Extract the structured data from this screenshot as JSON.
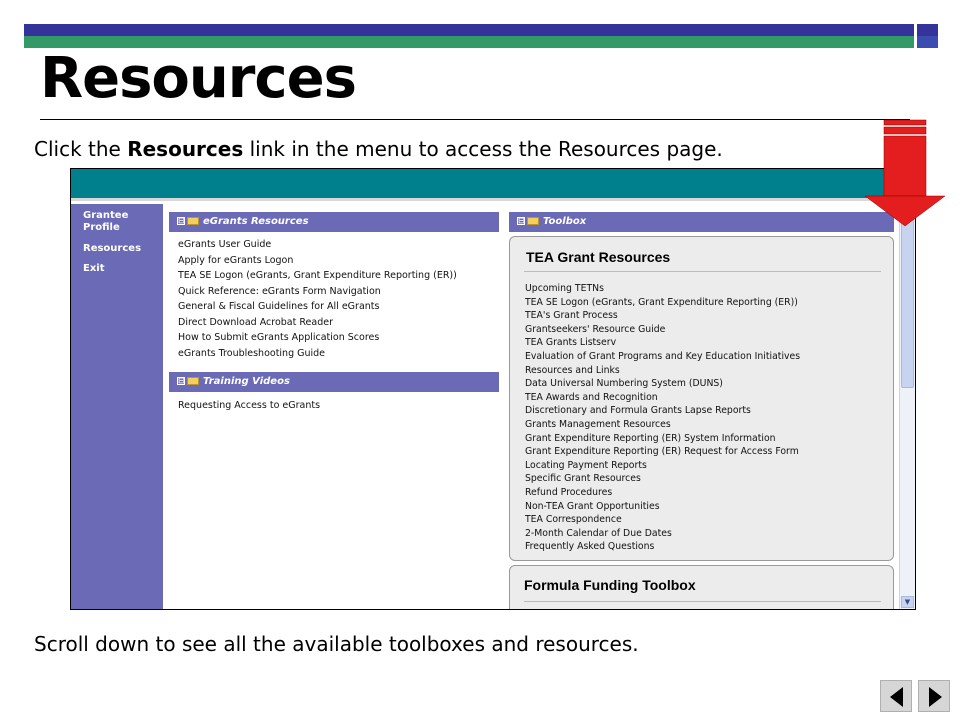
{
  "slide": {
    "title": "Resources",
    "intro_pre": "Click the ",
    "intro_bold": "Resources",
    "intro_post": " link in the menu to access the Resources page.",
    "footer": "Scroll down to see all the available toolboxes and resources."
  },
  "sidebar": {
    "items": [
      {
        "label": "Grantee Profile"
      },
      {
        "label": "Resources"
      },
      {
        "label": "Exit"
      }
    ]
  },
  "egrants": {
    "header": "eGrants Resources",
    "links": [
      "eGrants User Guide",
      "Apply for eGrants Logon",
      "TEA SE Logon (eGrants, Grant Expenditure Reporting (ER))",
      "Quick Reference: eGrants Form Navigation",
      "General & Fiscal Guidelines for All eGrants",
      "Direct Download Acrobat Reader",
      "How to Submit eGrants Application Scores",
      "eGrants Troubleshooting Guide"
    ]
  },
  "training": {
    "header": "Training Videos",
    "links": [
      "Requesting Access to eGrants"
    ]
  },
  "toolbox": {
    "header": "Toolbox",
    "card_title": "TEA Grant Resources",
    "links": [
      "Upcoming TETNs",
      "TEA SE Logon (eGrants, Grant Expenditure Reporting (ER))",
      "TEA's Grant Process",
      "Grantseekers' Resource Guide",
      "TEA Grants Listserv",
      "Evaluation of Grant Programs and Key Education Initiatives",
      "Resources and Links",
      "Data Universal Numbering System (DUNS)",
      "TEA Awards and Recognition",
      "Discretionary and Formula Grants Lapse Reports",
      "Grants Management Resources",
      "Grant Expenditure Reporting (ER) System Information",
      "Grant Expenditure Reporting (ER) Request for Access Form",
      "Locating Payment Reports",
      "Specific Grant Resources",
      "Refund Procedures",
      "Non-TEA Grant Opportunities",
      "TEA Correspondence",
      "2-Month Calendar of Due Dates",
      "Frequently Asked Questions"
    ],
    "card2_title": "Formula Funding Toolbox"
  },
  "icons": {
    "collapse": "⊟",
    "scroll_up": "▲",
    "scroll_down": "▼"
  },
  "colors": {
    "teal_bar": "#00808c",
    "sidebar": "#6a6ab6",
    "arrow": "#e41e1e",
    "title_bar_blue": "#333399",
    "title_bar_green": "#339966"
  }
}
